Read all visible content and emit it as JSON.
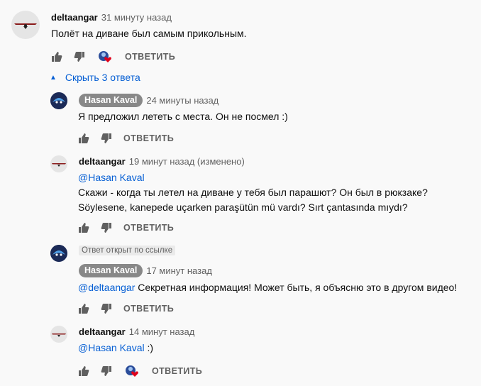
{
  "comments": [
    {
      "author": "deltaangar",
      "time": "31 минуту назад",
      "text": "Полёт на диване был самым прикольным.",
      "reply_label": "ОТВЕТИТЬ"
    }
  ],
  "replies_toggle": "Скрыть 3 ответа",
  "replies": [
    {
      "author": "Hasan Kaval",
      "time": "24 минуты назад",
      "text": "Я предложил лететь с места. Он не посмел :)",
      "reply_label": "ОТВЕТИТЬ"
    },
    {
      "author": "deltaangar",
      "time": "19 минут назад (изменено)",
      "mention": "@Hasan Kaval",
      "line1": "Скажи - когда ты летел на диване у тебя был парашют? Он был в рюкзаке?",
      "line2": "Söylesene, kanepede uçarken paraşütün mü vardı? Sırt çantasında mıydı?",
      "reply_label": "ОТВЕТИТЬ"
    },
    {
      "pinned": "Ответ открыт по ссылке",
      "author": "Hasan Kaval",
      "time": "17 минут назад",
      "mention": "@deltaangar",
      "text": " Секретная информация! Может быть, я объясню это в другом видео!",
      "reply_label": "ОТВЕТИТЬ"
    },
    {
      "author": "deltaangar",
      "time": "14 минут назад",
      "mention": "@Hasan Kaval",
      "text": " :)",
      "reply_label": "ОТВЕТИТЬ"
    }
  ],
  "icons": {
    "like": "thumb-up-icon",
    "dislike": "thumb-down-icon",
    "heart": "creator-heart-icon",
    "caret": "caret-up-icon"
  },
  "colors": {
    "link": "#065fd4",
    "heart": "#e0001b",
    "secondary": "#606060"
  }
}
